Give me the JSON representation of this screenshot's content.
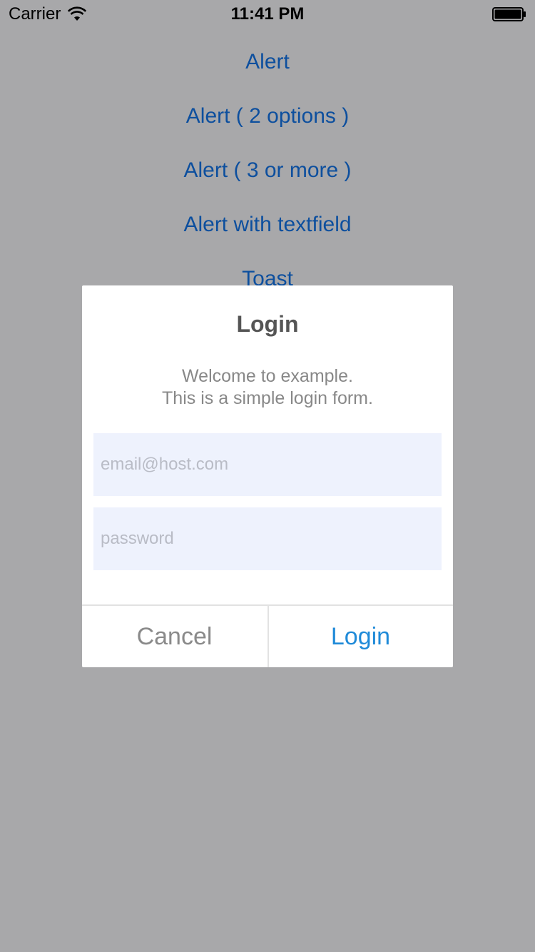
{
  "status_bar": {
    "carrier": "Carrier",
    "time": "11:41 PM"
  },
  "menu": {
    "items": [
      {
        "label": "Alert"
      },
      {
        "label": "Alert ( 2 options )"
      },
      {
        "label": "Alert ( 3 or more )"
      },
      {
        "label": "Alert with textfield"
      },
      {
        "label": "Toast"
      }
    ]
  },
  "dialog": {
    "title": "Login",
    "message_line1": "Welcome to example.",
    "message_line2": "This is a simple login form.",
    "email": {
      "value": "",
      "placeholder": "email@host.com"
    },
    "password": {
      "value": "",
      "placeholder": "password"
    },
    "cancel_label": "Cancel",
    "login_label": "Login"
  },
  "colors": {
    "overlay_background": "#a8a8aa",
    "menu_link": "#0d4f9e",
    "field_background": "#eef2fd",
    "login_accent": "#1f8ad8",
    "cancel_text": "#8a8a8a"
  },
  "icons": [
    "wifi-icon",
    "battery-icon"
  ]
}
